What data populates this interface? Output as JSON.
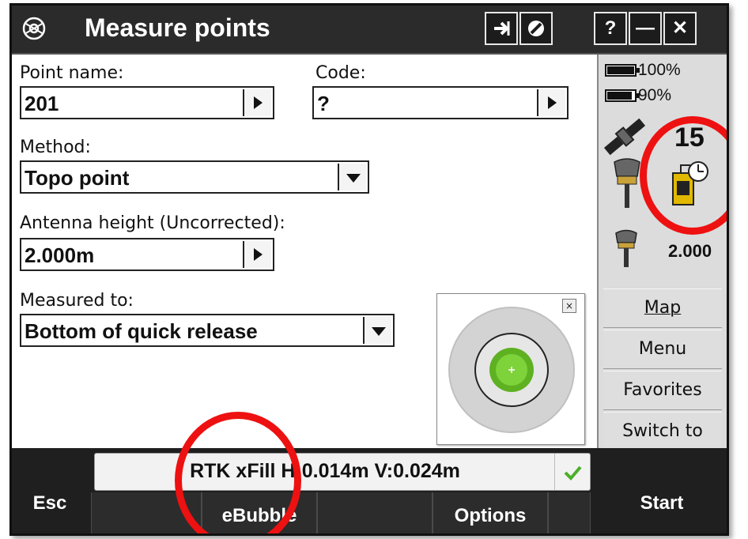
{
  "window": {
    "title": "Measure points",
    "buttons": {
      "help": "?",
      "minimize": "—",
      "close": "✕"
    }
  },
  "form": {
    "point_name": {
      "label": "Point name:",
      "value": "201"
    },
    "code": {
      "label": "Code:",
      "value": "?"
    },
    "method": {
      "label": "Method:",
      "value": "Topo point"
    },
    "antenna_height": {
      "label": "Antenna height (Uncorrected):",
      "value": "2.000m"
    },
    "measured_to": {
      "label": "Measured to:",
      "value": "Bottom of quick release"
    }
  },
  "status_panel": {
    "battery_1": {
      "text": "100%",
      "level": 1.0
    },
    "battery_2": {
      "text": "90%",
      "level": 0.9
    },
    "satellites": "15",
    "antenna_height": "2.000"
  },
  "side_nav": {
    "map": "Map",
    "menu": "Menu",
    "favorites": "Favorites",
    "switch_to": "Switch to"
  },
  "ebubble_widget": {
    "close_glyph": "×"
  },
  "status_bar": {
    "text": "RTK xFill H:0.014m V:0.024m"
  },
  "softkeys": {
    "esc": "Esc",
    "ebubble": "eBubble",
    "options": "Options",
    "start": "Start"
  },
  "colors": {
    "title_bar": "#2b2b2b",
    "bubble_green": "#6cc12a",
    "annotation_red": "#ee1111",
    "status_check": "#4caf2a"
  }
}
